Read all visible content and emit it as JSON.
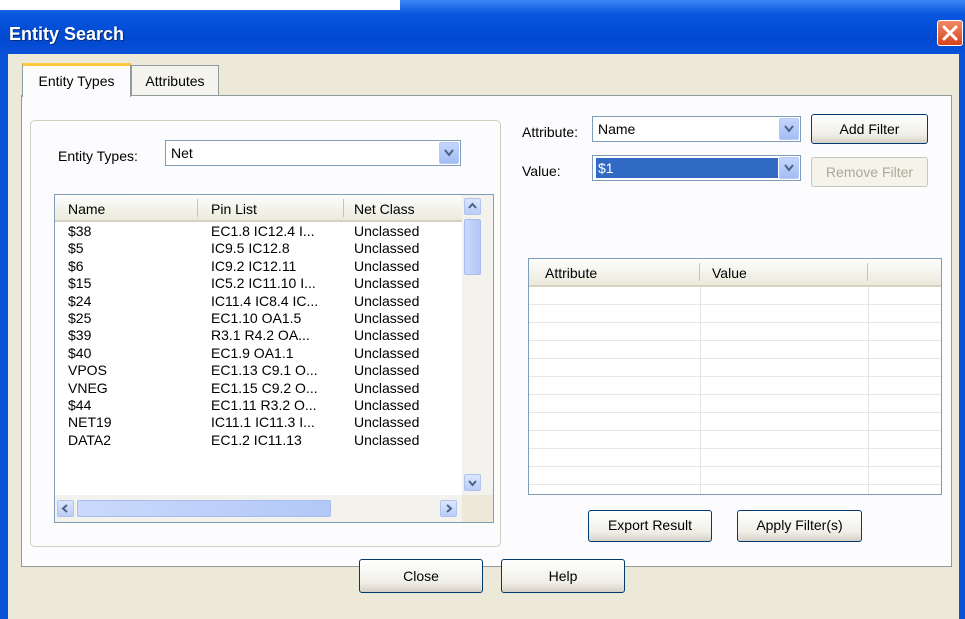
{
  "window": {
    "title": "Entity Search"
  },
  "tabs": [
    {
      "label": "Entity Types",
      "active": true
    },
    {
      "label": "Attributes",
      "active": false
    }
  ],
  "entity_types": {
    "label": "Entity Types:",
    "value": "Net"
  },
  "net_list": {
    "columns": [
      "Name",
      "Pin List",
      "Net Class"
    ],
    "rows": [
      {
        "name": "$38",
        "pins": "EC1.8 IC12.4 I...",
        "net_class": "Unclassed"
      },
      {
        "name": "$5",
        "pins": "IC9.5 IC12.8",
        "net_class": "Unclassed"
      },
      {
        "name": "$6",
        "pins": "IC9.2 IC12.11",
        "net_class": "Unclassed"
      },
      {
        "name": "$15",
        "pins": "IC5.2 IC11.10 I...",
        "net_class": "Unclassed"
      },
      {
        "name": "$24",
        "pins": "IC11.4 IC8.4 IC...",
        "net_class": "Unclassed"
      },
      {
        "name": "$25",
        "pins": "EC1.10 OA1.5",
        "net_class": "Unclassed"
      },
      {
        "name": "$39",
        "pins": "R3.1 R4.2 OA...",
        "net_class": "Unclassed"
      },
      {
        "name": "$40",
        "pins": "EC1.9 OA1.1",
        "net_class": "Unclassed"
      },
      {
        "name": "VPOS",
        "pins": "EC1.13 C9.1 O...",
        "net_class": "Unclassed"
      },
      {
        "name": "VNEG",
        "pins": "EC1.15 C9.2 O...",
        "net_class": "Unclassed"
      },
      {
        "name": "$44",
        "pins": "EC1.11 R3.2 O...",
        "net_class": "Unclassed"
      },
      {
        "name": "NET19",
        "pins": "IC11.1 IC11.3 I...",
        "net_class": "Unclassed"
      },
      {
        "name": "DATA2",
        "pins": "EC1.2 IC11.13",
        "net_class": "Unclassed"
      }
    ]
  },
  "filter": {
    "attribute_label": "Attribute:",
    "attribute_value": "Name",
    "value_label": "Value:",
    "value_value": "$1",
    "add_filter": "Add Filter",
    "remove_filter": "Remove Filter",
    "columns": [
      "Attribute",
      "Value"
    ],
    "export_result": "Export Result",
    "apply_filters": "Apply Filter(s)"
  },
  "footer": {
    "close": "Close",
    "help": "Help"
  },
  "colors": {
    "title_bar": "#0a52d8",
    "selection": "#316ac5",
    "tab_highlight": "#ffc73c",
    "dialog_bg": "#ece9d8"
  }
}
